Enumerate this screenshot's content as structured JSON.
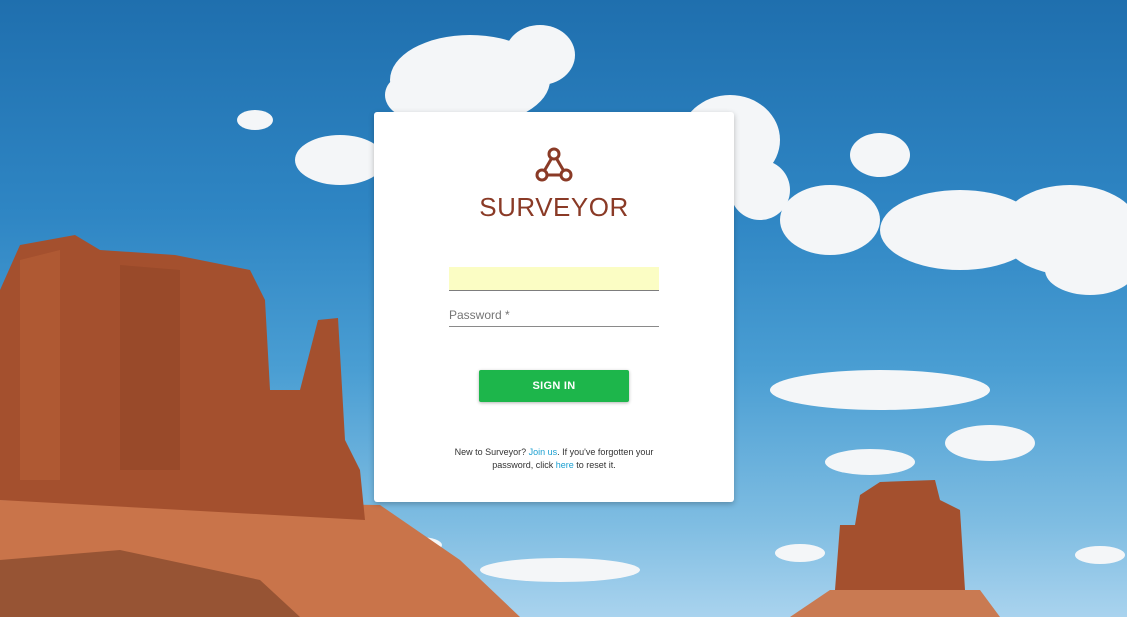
{
  "app": {
    "name": "SURVEYOR",
    "logo_icon": "molecule-triangle-icon",
    "brand_color": "#8a3a26"
  },
  "login": {
    "username_value": "",
    "password_placeholder": "Password *",
    "signin_label": "SIGN IN",
    "signin_color": "#1db64b"
  },
  "help": {
    "text_before_join": "New to Surveyor? ",
    "join_link": "Join us",
    "text_middle": ". If you've forgotten your password, click ",
    "reset_link": "here",
    "text_after": " to reset it.",
    "link_color": "#1a9fd0"
  }
}
